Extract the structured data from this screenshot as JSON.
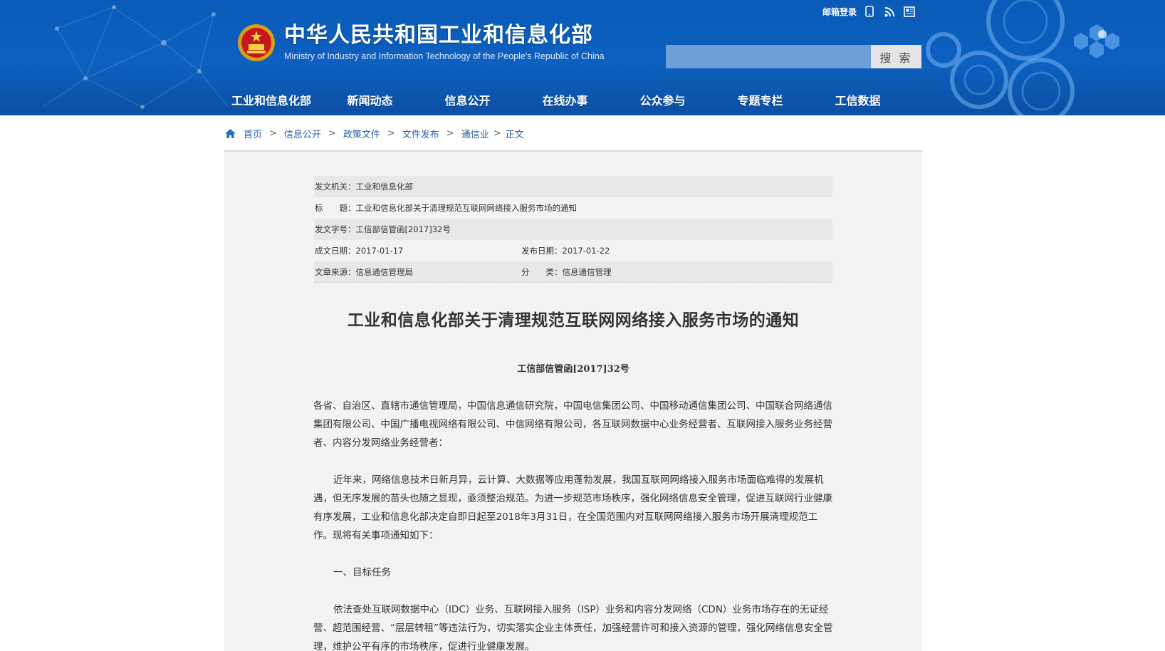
{
  "header": {
    "title_cn": "中华人民共和国工业和信息化部",
    "title_en": "Ministry of Industry and Information Technology of the People's Republic of China",
    "mail_login": "邮箱登录",
    "icons": [
      "mobile-icon",
      "rss-icon",
      "newspaper-icon"
    ],
    "search": {
      "value": "",
      "button": "搜 索"
    },
    "nav": [
      "工业和信息化部",
      "新闻动态",
      "信息公开",
      "在线办事",
      "公众参与",
      "专题专栏",
      "工信数据"
    ]
  },
  "breadcrumb": {
    "items": [
      "首页",
      "信息公开",
      "政策文件",
      "文件发布",
      "通信业"
    ],
    "separator": ">",
    "current": "正文"
  },
  "meta": {
    "issuer_label": "发文机关：",
    "issuer": "工业和信息化部",
    "title_label": "标　　题：",
    "title": "工业和信息化部关于清理规范互联网网络接入服务市场的通知",
    "docno_label": "发文字号：",
    "docno": "工信部信管函[2017]32号",
    "created_label": "成文日期：",
    "created": "2017-01-17",
    "published_label": "发布日期：",
    "published": "2017-01-22",
    "source_label": "文章来源：",
    "source": "信息通信管理局",
    "category_label": "分　　类：",
    "category": "信息通信管理"
  },
  "article": {
    "title": "工业和信息化部关于清理规范互联网网络接入服务市场的通知",
    "number": "工信部信管函[2017]32号",
    "paragraphs": [
      "各省、自治区、直辖市通信管理局，中国信息通信研究院，中国电信集团公司、中国移动通信集团公司、中国联合网络通信集团有限公司、中国广播电视网络有限公司、中信网络有限公司，各互联网数据中心业务经营者、互联网接入服务业务经营者、内容分发网络业务经营者：",
      "近年来，网络信息技术日新月异，云计算、大数据等应用蓬勃发展，我国互联网网络接入服务市场面临难得的发展机遇，但无序发展的苗头也随之显现，亟须整治规范。为进一步规范市场秩序，强化网络信息安全管理，促进互联网行业健康有序发展，工业和信息化部决定自即日起至2018年3月31日，在全国范围内对互联网网络接入服务市场开展清理规范工作。现将有关事项通知如下：",
      "一、目标任务",
      "依法查处互联网数据中心（IDC）业务、互联网接入服务（ISP）业务和内容分发网络（CDN）业务市场存在的无证经营、超范围经营、“层层转租”等违法行为，切实落实企业主体责任，加强经营许可和接入资源的管理，强化网络信息安全管理，维护公平有序的市场秩序，促进行业健康发展。"
    ]
  },
  "colors": {
    "header_blue": "#0d60c0",
    "link_blue": "#2b5fa5",
    "panel_gray": "#f3f3f3"
  }
}
